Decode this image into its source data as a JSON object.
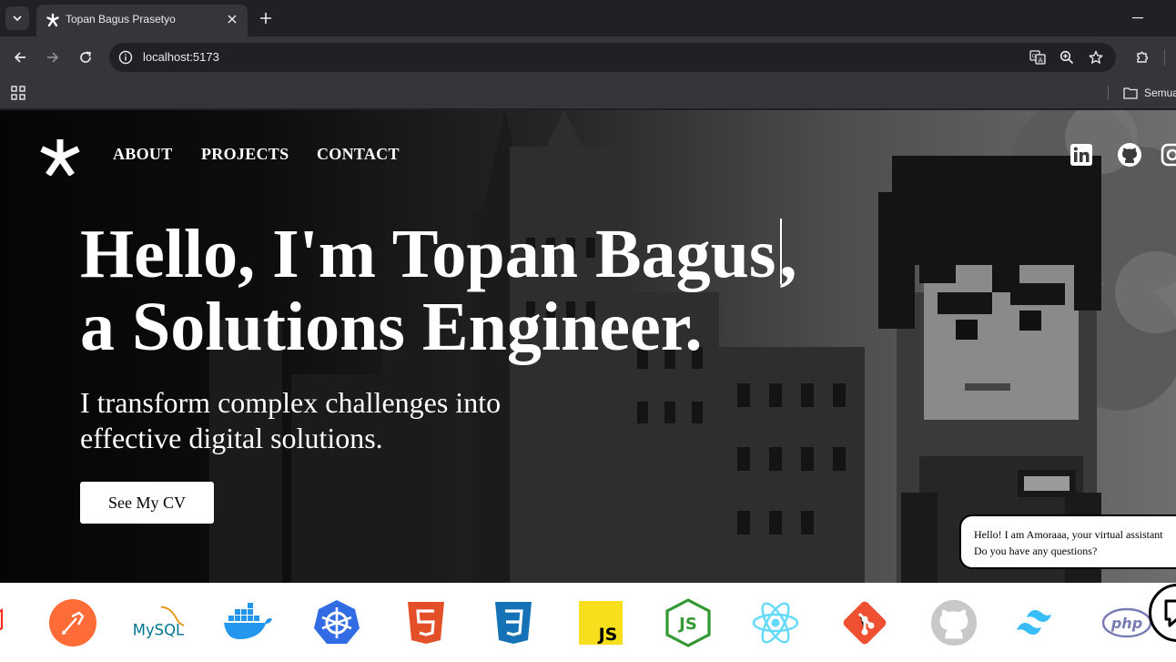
{
  "browser": {
    "tab_title": "Topan Bagus Prasetyo",
    "url": "localhost:5173",
    "bookmark_folder": "Semua"
  },
  "nav": {
    "links": [
      "ABOUT",
      "PROJECTS",
      "CONTACT"
    ],
    "social_icons": [
      "linkedin-icon",
      "github-icon",
      "instagram-icon"
    ]
  },
  "hero": {
    "headline_line1_typed": "Hello, I'm Topan Bagus",
    "headline_line1_rest": ",",
    "headline_line2": "a Solutions Engineer.",
    "subtitle_line1": "I transform complex challenges into",
    "subtitle_line2": "effective digital solutions.",
    "cv_button": "See My CV"
  },
  "chat": {
    "bubble_line1": "Hello! I am Amoraaa, your virtual assistant",
    "bubble_line2": "Do you have any questions?"
  },
  "tech_stack": {
    "mysql_label": "MySQL",
    "js_label": "JS",
    "php_label": "php",
    "items": [
      "laravel-icon",
      "postman-icon",
      "mysql-icon",
      "docker-icon",
      "kubernetes-icon",
      "html5-icon",
      "css3-icon",
      "javascript-icon",
      "nodejs-icon",
      "react-icon",
      "git-icon",
      "github-icon",
      "tailwind-icon",
      "php-icon"
    ]
  },
  "colors": {
    "chrome_dark": "#202124",
    "chrome_toolbar": "#35363a",
    "postman": "#ff6c37",
    "mysql": "#00758f",
    "docker": "#2496ed",
    "kubernetes": "#326ce5",
    "html5": "#e34f26",
    "css3": "#1572b6",
    "javascript": "#f7df1e",
    "nodejs": "#339933",
    "react": "#61dafb",
    "git": "#f05032",
    "tailwind": "#38bdf8",
    "php": "#777bb4"
  }
}
